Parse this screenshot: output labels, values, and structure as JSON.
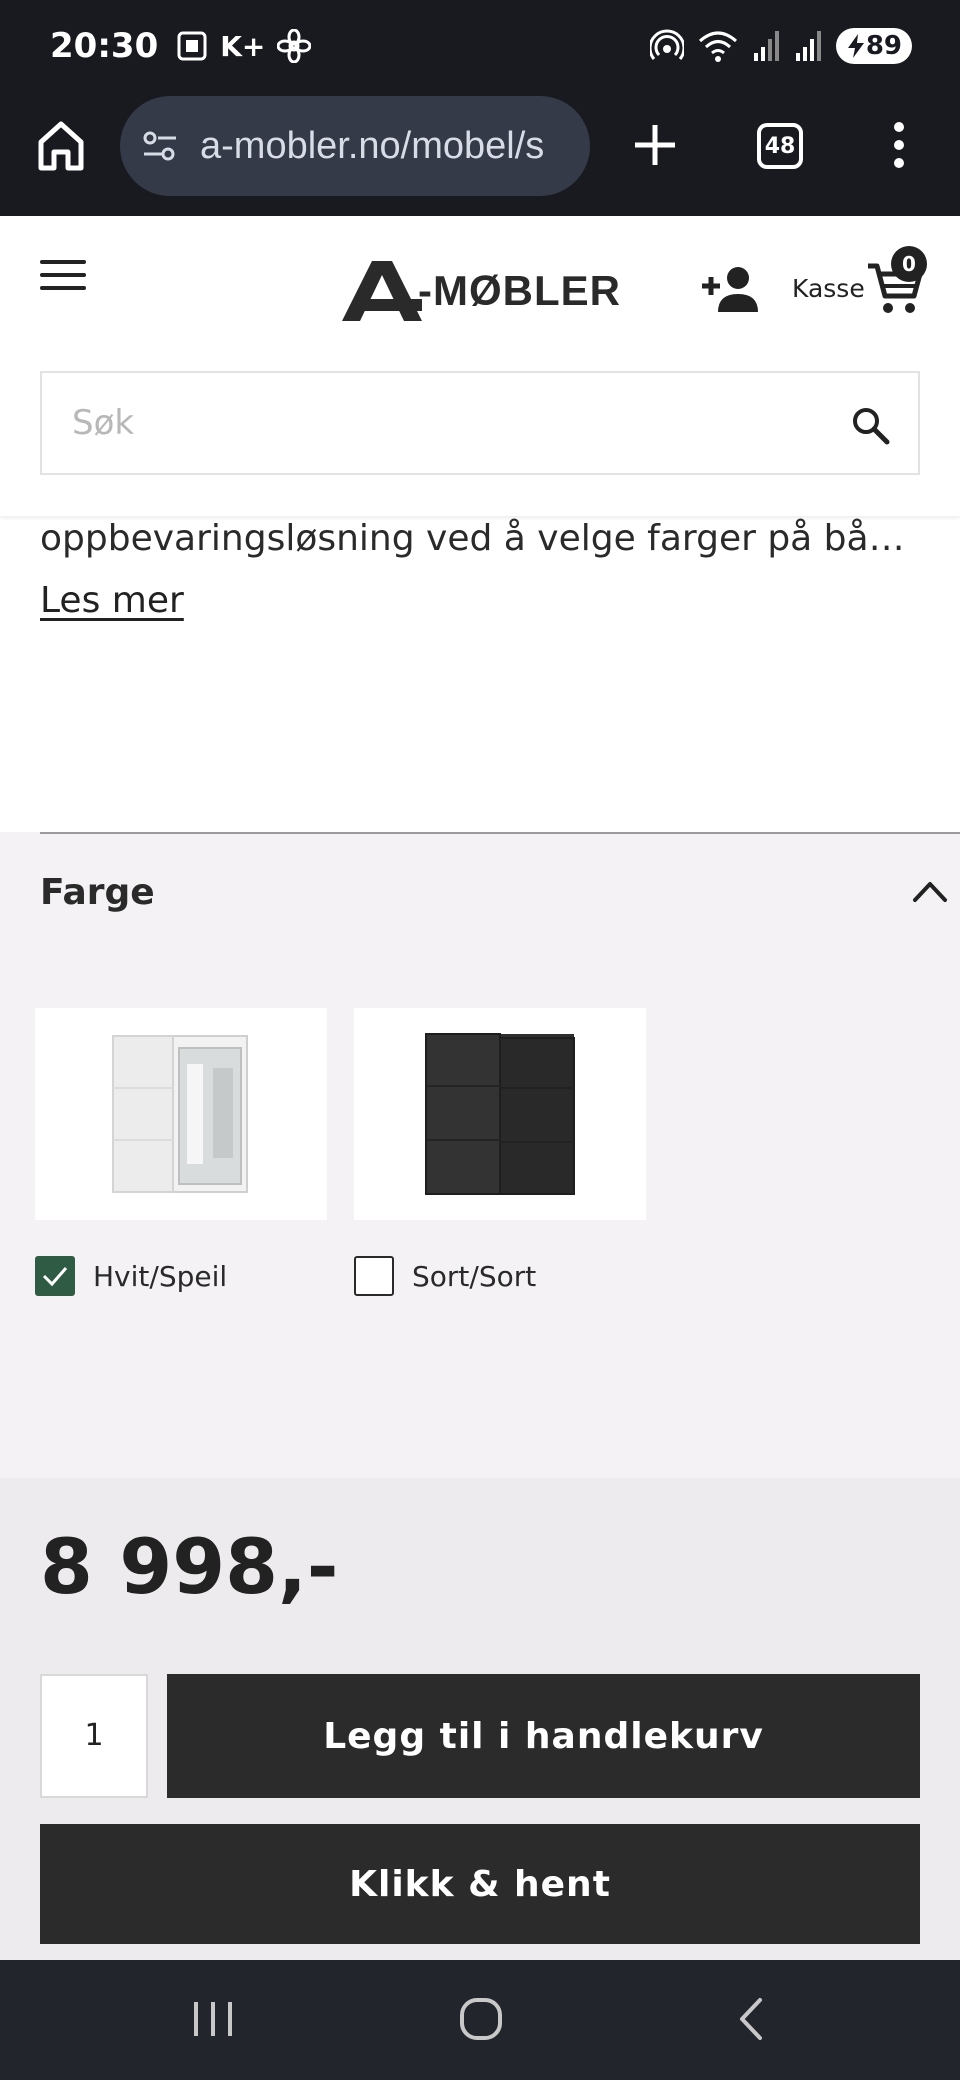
{
  "status_bar": {
    "time": "20:30",
    "carrier_icons": "K+",
    "battery": "89"
  },
  "browser": {
    "url": "a-mobler.no/mobel/s",
    "tab_count": "48"
  },
  "header": {
    "logo": "-MØBLER",
    "kasse_label": "Kasse",
    "cart_count": "0",
    "search_placeholder": "Søk"
  },
  "description": {
    "text": "oppbevaringsløsning ved å velge farger på bå…",
    "read_more": "Les mer"
  },
  "color_section": {
    "title": "Farge",
    "options": [
      {
        "label": "Hvit/Speil",
        "checked": true
      },
      {
        "label": "Sort/Sort",
        "checked": false
      }
    ]
  },
  "purchase": {
    "price": "8 998,-",
    "quantity": "1",
    "add_to_cart_label": "Legg til i handlekurv",
    "click_collect_label": "Klikk & hent"
  },
  "colors": {
    "dark_bar": "#181a20",
    "button_dark": "#2b2b2b",
    "checkbox_green": "#2f5a43",
    "section_bg": "#f4f2f5"
  }
}
